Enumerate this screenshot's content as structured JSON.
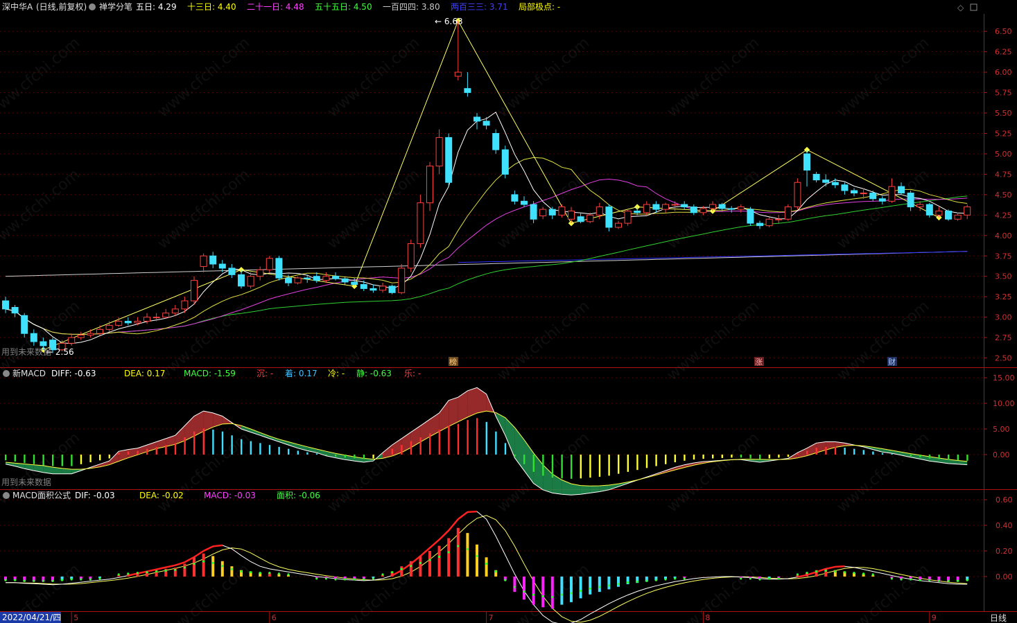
{
  "main": {
    "stock": "深中华A",
    "mode": "(日线,前复权)",
    "indicator": "禅学分笔",
    "ma_labels": [
      {
        "label": "五日:",
        "value": "4.29",
        "color": "#ffffff"
      },
      {
        "label": "十三日:",
        "value": "4.40",
        "color": "#ffff00"
      },
      {
        "label": "二十一日:",
        "value": "4.48",
        "color": "#ff40ff"
      },
      {
        "label": "五十五日:",
        "value": "4.50",
        "color": "#40ff40"
      },
      {
        "label": "一百四四:",
        "value": "3.80",
        "color": "#c8c8c8"
      },
      {
        "label": "两百三三:",
        "value": "3.71",
        "color": "#4040ff"
      },
      {
        "label": "局部极点:",
        "value": "-",
        "color": "#ffff00"
      }
    ],
    "future_note": "用到未来数据",
    "high_label": "6.63",
    "low_label": "2.56",
    "markers": [
      "榜",
      "涨",
      "财"
    ],
    "icons": [
      "diamond-icon",
      "square-icon",
      "maximize-icon"
    ]
  },
  "macd1": {
    "title": "新MACD",
    "items": [
      {
        "label": "DIFF:",
        "value": "-0.63",
        "color": "#ffffff"
      },
      {
        "label": "DEA:",
        "value": "0.17",
        "color": "#ffff00"
      },
      {
        "label": "MACD:",
        "value": "-1.59",
        "color": "#40ff40"
      },
      {
        "label": "沉:",
        "value": "-",
        "color": "#ff4040"
      },
      {
        "label": "着:",
        "value": "0.17",
        "color": "#40c0ff"
      },
      {
        "label": "冷:",
        "value": "-",
        "color": "#ffff00"
      },
      {
        "label": "静:",
        "value": "-0.63",
        "color": "#40ff40"
      },
      {
        "label": "乐:",
        "value": "-",
        "color": "#ff4040"
      }
    ],
    "future_note": "用到未来数据"
  },
  "macd2": {
    "title": "MACD面积公式",
    "items": [
      {
        "label": "DIF:",
        "value": "-0.03",
        "color": "#ffffff"
      },
      {
        "label": "DEA:",
        "value": "-0.02",
        "color": "#ffff00"
      },
      {
        "label": "MACD:",
        "value": "-0.03",
        "color": "#ff40ff"
      },
      {
        "label": "面积:",
        "value": "-0.06",
        "color": "#40ff40"
      }
    ]
  },
  "bottom": {
    "date": "2022/04/21/四",
    "months": [
      "5",
      "6",
      "7",
      "8",
      "9"
    ],
    "period": "日线"
  },
  "watermark": "www.cfchi.com",
  "chart_data": [
    {
      "type": "candlestick",
      "ylim": [
        2.42,
        6.68
      ],
      "yticks": [
        "6.50",
        "6.25",
        "6.00",
        "5.75",
        "5.50",
        "5.25",
        "5.00",
        "4.75",
        "4.50",
        "4.25",
        "4.00",
        "3.75",
        "3.50",
        "3.25",
        "3.00",
        "2.75",
        "2.50"
      ],
      "close": [
        3.1,
        3.05,
        2.8,
        2.7,
        2.65,
        2.6,
        2.68,
        2.75,
        2.78,
        2.8,
        2.85,
        2.9,
        2.95,
        2.93,
        2.95,
        3.0,
        3.0,
        3.05,
        3.1,
        3.2,
        3.45,
        3.75,
        3.65,
        3.6,
        3.52,
        3.38,
        3.5,
        3.58,
        3.72,
        3.48,
        3.42,
        3.48,
        3.47,
        3.45,
        3.5,
        3.47,
        3.43,
        3.4,
        3.35,
        3.33,
        3.38,
        3.3,
        3.6,
        3.9,
        4.4,
        4.85,
        5.2,
        4.65,
        6.0,
        5.75,
        5.4,
        5.35,
        5.05,
        4.75,
        4.42,
        4.38,
        4.2,
        4.32,
        4.25,
        4.35,
        4.3,
        4.17,
        4.25,
        4.35,
        4.1,
        4.15,
        4.3,
        4.28,
        4.38,
        4.32,
        4.38,
        4.38,
        4.35,
        4.28,
        4.33,
        4.38,
        4.33,
        4.32,
        4.35,
        4.15,
        4.12,
        4.2,
        4.2,
        4.35,
        4.65,
        4.8,
        4.68,
        4.65,
        4.62,
        4.55,
        4.52,
        4.52,
        4.45,
        4.42,
        4.6,
        4.52,
        4.35,
        4.38,
        4.25,
        4.3,
        4.2,
        4.25,
        4.35
      ],
      "open": [
        3.2,
        3.12,
        3.02,
        2.8,
        2.7,
        2.72,
        2.6,
        2.68,
        2.75,
        2.78,
        2.8,
        2.85,
        2.9,
        2.95,
        2.93,
        2.95,
        3.0,
        3.0,
        3.05,
        3.1,
        3.2,
        3.62,
        3.75,
        3.65,
        3.6,
        3.52,
        3.38,
        3.5,
        3.58,
        3.72,
        3.48,
        3.42,
        3.48,
        3.5,
        3.45,
        3.5,
        3.47,
        3.43,
        3.4,
        3.35,
        3.33,
        3.38,
        3.3,
        3.6,
        3.9,
        4.4,
        4.85,
        5.2,
        5.95,
        5.8,
        5.45,
        5.4,
        5.25,
        5.05,
        4.5,
        4.42,
        4.38,
        4.24,
        4.32,
        4.25,
        4.2,
        4.23,
        4.17,
        4.25,
        4.35,
        4.1,
        4.15,
        4.3,
        4.28,
        4.38,
        4.32,
        4.38,
        4.38,
        4.35,
        4.28,
        4.33,
        4.38,
        4.33,
        4.32,
        4.32,
        4.15,
        4.12,
        4.2,
        4.2,
        4.35,
        5.0,
        4.75,
        4.68,
        4.65,
        4.62,
        4.55,
        4.52,
        4.52,
        4.45,
        4.42,
        4.6,
        4.52,
        4.35,
        4.38,
        4.25,
        4.3,
        4.2,
        4.25
      ],
      "high": [
        3.25,
        3.15,
        3.05,
        2.85,
        2.75,
        2.75,
        2.72,
        2.8,
        2.82,
        2.85,
        2.9,
        2.95,
        3.0,
        3.0,
        3.0,
        3.05,
        3.05,
        3.1,
        3.15,
        3.25,
        3.5,
        3.78,
        3.8,
        3.7,
        3.65,
        3.58,
        3.55,
        3.62,
        3.75,
        3.75,
        3.52,
        3.5,
        3.52,
        3.55,
        3.55,
        3.55,
        3.5,
        3.48,
        3.45,
        3.4,
        3.42,
        3.4,
        3.65,
        3.95,
        4.5,
        4.9,
        5.3,
        5.25,
        6.63,
        6.0,
        5.5,
        5.45,
        5.3,
        5.1,
        4.55,
        4.48,
        4.42,
        4.35,
        4.35,
        4.38,
        4.35,
        4.28,
        4.28,
        4.4,
        4.38,
        4.18,
        4.33,
        4.35,
        4.42,
        4.42,
        4.4,
        4.42,
        4.42,
        4.38,
        4.36,
        4.42,
        4.4,
        4.36,
        4.38,
        4.35,
        4.18,
        4.22,
        4.25,
        4.38,
        4.7,
        5.05,
        4.78,
        4.75,
        4.7,
        4.65,
        4.58,
        4.58,
        4.55,
        4.48,
        4.7,
        4.65,
        4.55,
        4.42,
        4.4,
        4.35,
        4.32,
        4.28,
        4.38
      ],
      "low": [
        3.05,
        3.0,
        2.75,
        2.65,
        2.6,
        2.56,
        2.58,
        2.65,
        2.72,
        2.75,
        2.78,
        2.82,
        2.88,
        2.9,
        2.9,
        2.92,
        2.95,
        2.98,
        3.02,
        3.05,
        3.15,
        3.55,
        3.6,
        3.55,
        3.48,
        3.35,
        3.35,
        3.45,
        3.55,
        3.45,
        3.38,
        3.4,
        3.42,
        3.42,
        3.42,
        3.45,
        3.4,
        3.38,
        3.32,
        3.3,
        3.3,
        3.28,
        3.28,
        3.55,
        3.85,
        4.3,
        4.75,
        4.6,
        5.9,
        5.7,
        5.3,
        5.3,
        5.0,
        4.7,
        4.38,
        4.35,
        4.15,
        4.2,
        4.2,
        4.22,
        4.15,
        4.15,
        4.15,
        4.2,
        4.05,
        4.08,
        4.12,
        4.25,
        4.25,
        4.28,
        4.28,
        4.3,
        4.32,
        4.25,
        4.25,
        4.3,
        4.3,
        4.28,
        4.28,
        4.12,
        4.08,
        4.1,
        4.15,
        4.18,
        4.32,
        4.6,
        4.65,
        4.6,
        4.58,
        4.5,
        4.48,
        4.45,
        4.42,
        4.38,
        4.4,
        4.5,
        4.3,
        4.3,
        4.22,
        4.22,
        4.18,
        4.18,
        4.2
      ]
    },
    {
      "type": "bar",
      "ylim": [
        -6.5,
        16.5
      ],
      "yticks": [
        "15.00",
        "10.00",
        "5.00",
        "0.00"
      ],
      "values": [
        -1.5,
        -1.8,
        -2.2,
        -2.5,
        -2.8,
        -3.0,
        -3.0,
        -3.0,
        -2.5,
        -2.0,
        -1.5,
        -1.0,
        0.5,
        0.8,
        1.0,
        1.5,
        2.0,
        2.5,
        3.0,
        4.5,
        6.0,
        6.8,
        6.5,
        6.0,
        5.0,
        4.0,
        3.5,
        3.0,
        2.5,
        2.0,
        1.5,
        1.0,
        0.6,
        0.3,
        -0.2,
        -0.5,
        -0.8,
        -1.0,
        -1.2,
        -1.0,
        0.3,
        1.5,
        2.5,
        3.5,
        4.5,
        5.5,
        6.5,
        7.5,
        8.0,
        9.0,
        9.5,
        8.5,
        6.0,
        3.0,
        -0.5,
        -2.5,
        -4.5,
        -5.5,
        -6.0,
        -6.2,
        -6.3,
        -6.2,
        -6.0,
        -5.8,
        -5.5,
        -5.0,
        -4.5,
        -4.0,
        -3.5,
        -3.0,
        -2.5,
        -2.0,
        -1.6,
        -1.3,
        -1.1,
        -1.0,
        -0.9,
        -0.8,
        -0.8,
        -1.0,
        -1.2,
        -1.0,
        -0.8,
        -0.6,
        0.3,
        1.0,
        1.8,
        2.0,
        2.0,
        1.8,
        1.5,
        1.2,
        0.8,
        0.4,
        0.2,
        -0.1,
        -0.4,
        -0.7,
        -1.0,
        -1.2,
        -1.4,
        -1.5,
        -1.59
      ]
    },
    {
      "type": "bar",
      "ylim": [
        -0.26,
        0.66
      ],
      "yticks": [
        "0.60",
        "0.40",
        "0.20",
        "0.00"
      ],
      "values": [
        -0.03,
        -0.03,
        -0.04,
        -0.04,
        -0.04,
        -0.04,
        -0.03,
        -0.02,
        -0.02,
        -0.02,
        -0.01,
        0.0,
        0.01,
        0.02,
        0.03,
        0.04,
        0.05,
        0.06,
        0.07,
        0.1,
        0.15,
        0.18,
        0.16,
        0.12,
        0.08,
        0.05,
        0.04,
        0.03,
        0.03,
        0.02,
        0.01,
        0.0,
        0.0,
        -0.01,
        -0.01,
        -0.02,
        -0.02,
        -0.02,
        -0.02,
        -0.01,
        0.01,
        0.04,
        0.08,
        0.12,
        0.16,
        0.2,
        0.24,
        0.3,
        0.38,
        0.34,
        0.25,
        0.15,
        0.05,
        -0.03,
        -0.12,
        -0.18,
        -0.22,
        -0.24,
        -0.25,
        -0.22,
        -0.2,
        -0.17,
        -0.14,
        -0.12,
        -0.1,
        -0.08,
        -0.06,
        -0.05,
        -0.04,
        -0.03,
        -0.02,
        -0.01,
        -0.01,
        0.0,
        0.0,
        0.0,
        0.0,
        0.0,
        -0.01,
        -0.01,
        -0.02,
        -0.01,
        -0.01,
        0.0,
        0.01,
        0.03,
        0.05,
        0.06,
        0.05,
        0.04,
        0.03,
        0.02,
        0.01,
        0.0,
        -0.01,
        -0.02,
        -0.02,
        -0.03,
        -0.03,
        -0.04,
        -0.04,
        -0.04,
        -0.03
      ]
    }
  ]
}
